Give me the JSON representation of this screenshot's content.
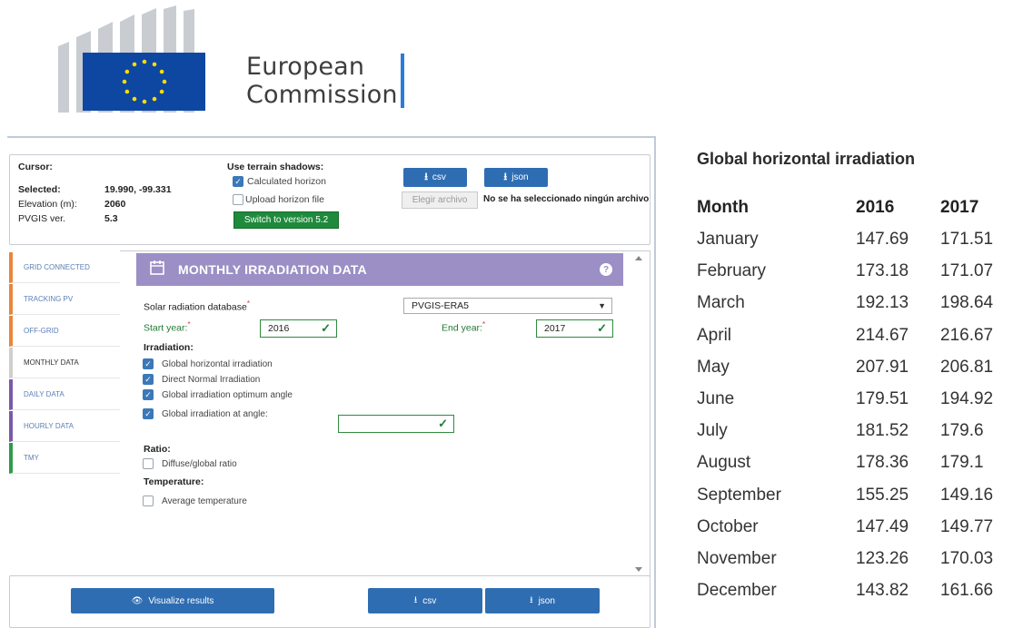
{
  "logo": {
    "line1": "European",
    "line2": "Commission"
  },
  "info": {
    "cursor_label": "Cursor:",
    "selected_label": "Selected:",
    "selected_value": "19.990, -99.331",
    "elevation_label": "Elevation (m):",
    "elevation_value": "2060",
    "pvgis_label": "PVGIS ver.",
    "pvgis_value": "5.3"
  },
  "terrain": {
    "title": "Use terrain shadows:",
    "calculated": "Calculated horizon",
    "calculated_checked": true,
    "upload": "Upload horizon file",
    "upload_checked": false,
    "switch_button": "Switch to version 5.2"
  },
  "top_downloads": {
    "csv": "csv",
    "json": "json"
  },
  "file": {
    "button": "Elegir archivo",
    "status": "No se ha seleccionado ningún archivo"
  },
  "nav": [
    {
      "label": "GRID CONNECTED",
      "color": "#e8863a"
    },
    {
      "label": "TRACKING PV",
      "color": "#e8863a"
    },
    {
      "label": "OFF-GRID",
      "color": "#e8863a"
    },
    {
      "label": "MONTHLY DATA",
      "color": "#cfcfcf"
    },
    {
      "label": "DAILY DATA",
      "color": "#7a5aa8"
    },
    {
      "label": "HOURLY DATA",
      "color": "#7a5aa8"
    },
    {
      "label": "TMY",
      "color": "#2e9b4a"
    }
  ],
  "section": {
    "title": "MONTHLY IRRADIATION DATA",
    "help": "?",
    "db_label": "Solar radiation database",
    "db_value": "PVGIS-ERA5",
    "start_label": "Start year:",
    "start_value": "2016",
    "end_label": "End year:",
    "end_value": "2017",
    "irradiation_heading": "Irradiation:",
    "options": [
      {
        "label": "Global horizontal irradiation",
        "checked": true
      },
      {
        "label": "Direct Normal Irradiation",
        "checked": true
      },
      {
        "label": "Global irradiation optimum angle",
        "checked": true
      },
      {
        "label": "Global irradiation at angle:",
        "checked": true
      }
    ],
    "ratio_heading": "Ratio:",
    "ratio_option": "Diffuse/global ratio",
    "temperature_heading": "Temperature:",
    "temperature_option": "Average temperature"
  },
  "bottom": {
    "visualize": "Visualize results",
    "csv": "csv",
    "json": "json"
  },
  "table": {
    "title": "Global horizontal irradiation",
    "headers": [
      "Month",
      "2016",
      "2017"
    ],
    "rows": [
      [
        "January",
        "147.69",
        "171.51"
      ],
      [
        "February",
        "173.18",
        "171.07"
      ],
      [
        "March",
        "192.13",
        "198.64"
      ],
      [
        "April",
        "214.67",
        "216.67"
      ],
      [
        "May",
        "207.91",
        "206.81"
      ],
      [
        "June",
        "179.51",
        "194.92"
      ],
      [
        "July",
        "181.52",
        "179.6"
      ],
      [
        "August",
        "178.36",
        "179.1"
      ],
      [
        "September",
        "155.25",
        "149.16"
      ],
      [
        "October",
        "147.49",
        "149.77"
      ],
      [
        "November",
        "123.26",
        "170.03"
      ],
      [
        "December",
        "143.82",
        "161.66"
      ]
    ]
  }
}
